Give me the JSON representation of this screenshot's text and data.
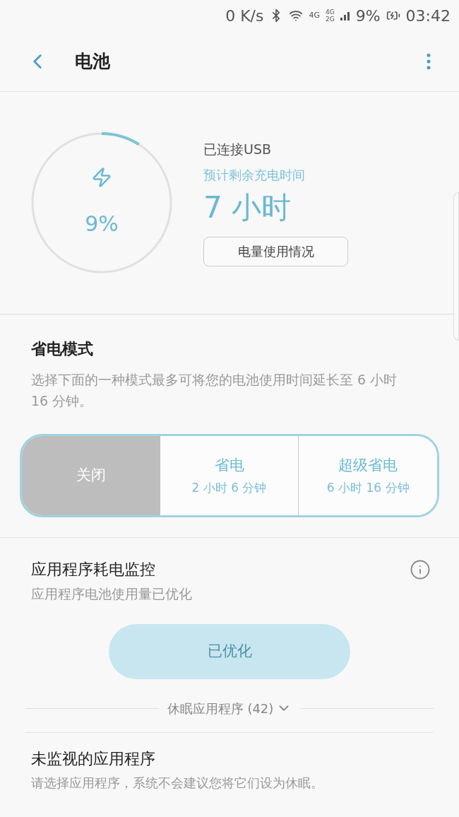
{
  "status_bar": {
    "speed": "0 K/s",
    "network_1": "4G",
    "network_2": "4G",
    "network_3": "2G",
    "battery": "9%",
    "time": "03:42"
  },
  "header": {
    "title": "电池"
  },
  "battery": {
    "level": 0.09,
    "percent": "9%",
    "connection": "已连接USB",
    "remaining_label": "预计剩余充电时间",
    "remaining": "7 小时",
    "usage_button": "电量使用情况"
  },
  "power_saving": {
    "title": "省电模式",
    "description": "选择下面的一种模式最多可将您的电池使用时间延长至 6 小时 16 分钟。",
    "modes": [
      {
        "label": "关闭",
        "selected": true
      },
      {
        "label": "省电",
        "duration": "2 小时 6 分钟",
        "selected": false
      },
      {
        "label": "超级省电",
        "duration": "6 小时 16 分钟",
        "selected": false
      }
    ]
  },
  "app_monitor": {
    "title": "应用程序耗电监控",
    "subtitle": "应用程序电池使用量已优化",
    "button": "已优化",
    "button_disabled": true,
    "sleeping_apps": "休眠应用程序 (42)",
    "expanded": false
  },
  "unmonitored": {
    "title": "未监视的应用程序",
    "description": "请选择应用程序，系统不会建议您将它们设为休眠。"
  }
}
